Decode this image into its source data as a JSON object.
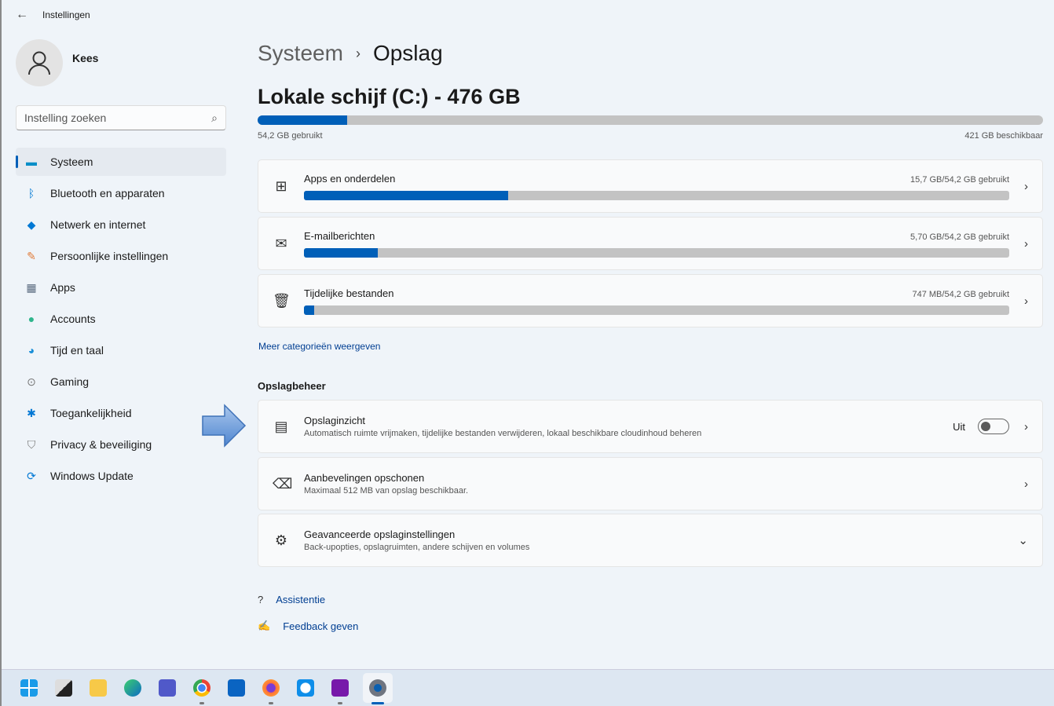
{
  "window": {
    "title": "Instellingen"
  },
  "user": {
    "name": "Kees"
  },
  "search": {
    "placeholder": "Instelling zoeken"
  },
  "sidebar": {
    "items": [
      {
        "label": "Systeem",
        "icon": "monitor-icon",
        "active": true
      },
      {
        "label": "Bluetooth en apparaten",
        "icon": "bluetooth-icon"
      },
      {
        "label": "Netwerk en internet",
        "icon": "wifi-icon"
      },
      {
        "label": "Persoonlijke instellingen",
        "icon": "brush-icon"
      },
      {
        "label": "Apps",
        "icon": "apps-icon"
      },
      {
        "label": "Accounts",
        "icon": "person-icon"
      },
      {
        "label": "Tijd en taal",
        "icon": "clock-globe-icon"
      },
      {
        "label": "Gaming",
        "icon": "gamepad-icon"
      },
      {
        "label": "Toegankelijkheid",
        "icon": "accessibility-icon"
      },
      {
        "label": "Privacy & beveiliging",
        "icon": "shield-icon"
      },
      {
        "label": "Windows Update",
        "icon": "update-icon"
      }
    ]
  },
  "breadcrumb": {
    "parent": "Systeem",
    "current": "Opslag"
  },
  "disk": {
    "title": "Lokale schijf (C:) - 476 GB",
    "used": "54,2 GB gebruikt",
    "free": "421 GB beschikbaar",
    "used_percent": 11.4
  },
  "categories": [
    {
      "title": "Apps en onderdelen",
      "value": "15,7 GB/54,2 GB gebruikt",
      "percent": 29,
      "icon": "apps-features-icon"
    },
    {
      "title": "E-mailberichten",
      "value": "5,70 GB/54,2 GB gebruikt",
      "percent": 10.5,
      "icon": "mail-icon"
    },
    {
      "title": "Tijdelijke bestanden",
      "value": "747 MB/54,2 GB gebruikt",
      "percent": 1.4,
      "icon": "trash-icon"
    }
  ],
  "more_link": "Meer categorieën weergeven",
  "management": {
    "heading": "Opslagbeheer",
    "items": [
      {
        "title": "Opslaginzicht",
        "sub": "Automatisch ruimte vrijmaken, tijdelijke bestanden verwijderen, lokaal beschikbare cloudinhoud beheren",
        "toggle_label": "Uit",
        "toggle_on": false
      },
      {
        "title": "Aanbevelingen opschonen",
        "sub": "Maximaal 512 MB van opslag beschikbaar."
      },
      {
        "title": "Geavanceerde opslaginstellingen",
        "sub": "Back-upopties, opslagruimten, andere schijven en volumes"
      }
    ]
  },
  "help": {
    "assist": "Assistentie",
    "feedback": "Feedback geven"
  },
  "taskbar": [
    "start",
    "task-view",
    "file-explorer",
    "edge",
    "teams",
    "chrome",
    "outlook",
    "firefox",
    "teamviewer",
    "onenote",
    "settings"
  ],
  "colors": {
    "accent": "#005fb8",
    "bar_bg": "#c3c3c3"
  }
}
